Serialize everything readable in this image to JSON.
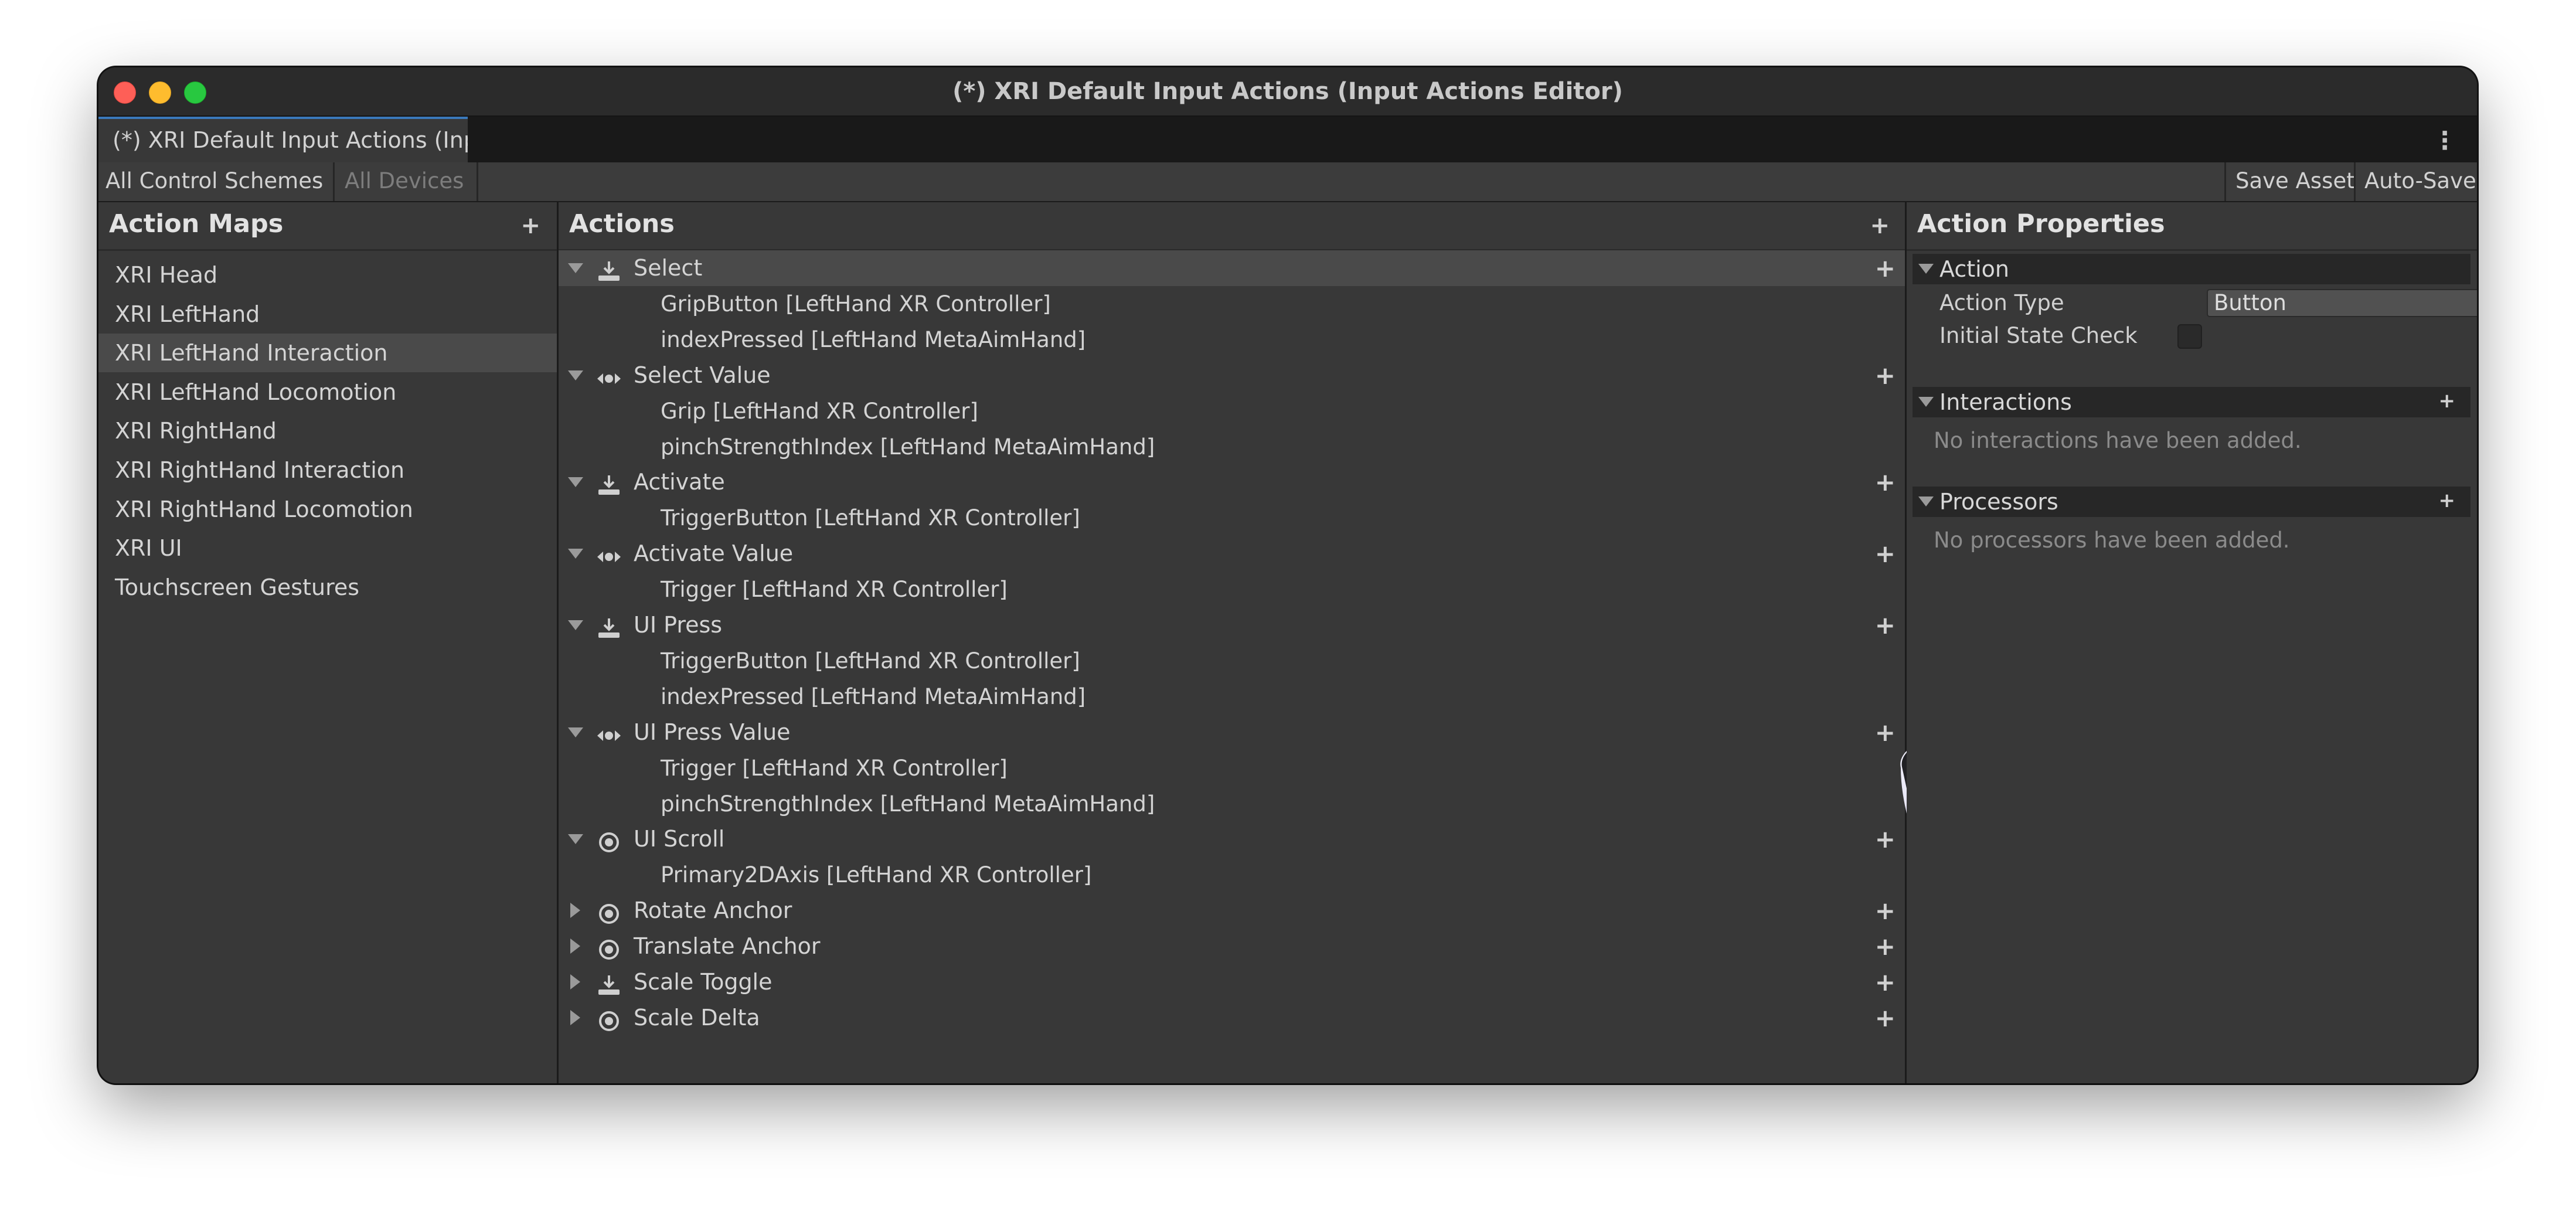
{
  "window": {
    "title": "(*) XRI Default Input Actions (Input Actions Editor)",
    "tab_label": "(*) XRI Default Input Actions (Inpu"
  },
  "toolbar": {
    "control_scheme": "All Control Schemes",
    "devices": "All Devices",
    "save_asset": "Save Asset",
    "auto_save": "Auto-Save"
  },
  "action_maps": {
    "title": "Action Maps",
    "items": [
      "XRI Head",
      "XRI LeftHand",
      "XRI LeftHand Interaction",
      "XRI LeftHand Locomotion",
      "XRI RightHand",
      "XRI RightHand Interaction",
      "XRI RightHand Locomotion",
      "XRI UI",
      "Touchscreen Gestures"
    ],
    "selected": "XRI LeftHand Interaction"
  },
  "actions": {
    "title": "Actions",
    "selected": "Select",
    "rows": [
      {
        "kind": "action",
        "label": "Select",
        "icon": "button-action-icon",
        "expanded": true
      },
      {
        "kind": "binding",
        "label": "GripButton [LeftHand XR Controller]"
      },
      {
        "kind": "binding",
        "label": "indexPressed [LeftHand MetaAimHand]"
      },
      {
        "kind": "action",
        "label": "Select Value",
        "icon": "value-action-icon",
        "expanded": true
      },
      {
        "kind": "binding",
        "label": "Grip [LeftHand XR Controller]"
      },
      {
        "kind": "binding",
        "label": "pinchStrengthIndex [LeftHand MetaAimHand]"
      },
      {
        "kind": "action",
        "label": "Activate",
        "icon": "button-action-icon",
        "expanded": true
      },
      {
        "kind": "binding",
        "label": "TriggerButton [LeftHand XR Controller]"
      },
      {
        "kind": "action",
        "label": "Activate Value",
        "icon": "value-action-icon",
        "expanded": true
      },
      {
        "kind": "binding",
        "label": "Trigger [LeftHand XR Controller]"
      },
      {
        "kind": "action",
        "label": "UI Press",
        "icon": "button-action-icon",
        "expanded": true
      },
      {
        "kind": "binding",
        "label": "TriggerButton [LeftHand XR Controller]"
      },
      {
        "kind": "binding",
        "label": "indexPressed [LeftHand MetaAimHand]"
      },
      {
        "kind": "action",
        "label": "UI Press Value",
        "icon": "value-action-icon",
        "expanded": true
      },
      {
        "kind": "binding",
        "label": "Trigger [LeftHand XR Controller]"
      },
      {
        "kind": "binding",
        "label": "pinchStrengthIndex [LeftHand MetaAimHand]"
      },
      {
        "kind": "action",
        "label": "UI Scroll",
        "icon": "passthrough-action-icon",
        "expanded": true
      },
      {
        "kind": "binding",
        "label": "Primary2DAxis [LeftHand XR Controller]"
      },
      {
        "kind": "action",
        "label": "Rotate Anchor",
        "icon": "passthrough-action-icon",
        "expanded": false
      },
      {
        "kind": "action",
        "label": "Translate Anchor",
        "icon": "passthrough-action-icon",
        "expanded": false
      },
      {
        "kind": "action",
        "label": "Scale Toggle",
        "icon": "button-action-icon",
        "expanded": false
      },
      {
        "kind": "action",
        "label": "Scale Delta",
        "icon": "passthrough-action-icon",
        "expanded": false
      }
    ]
  },
  "properties": {
    "title": "Action Properties",
    "action_section": "Action",
    "action_type_label": "Action Type",
    "action_type_value": "Button",
    "initial_state_label": "Initial State Check",
    "initial_state_checked": false,
    "interactions_section": "Interactions",
    "interactions_empty": "No interactions have been added.",
    "processors_section": "Processors",
    "processors_empty": "No processors have been added."
  },
  "colors": {
    "window_bg": "#383838",
    "selected_row": "#4a4a4a",
    "tab_accent": "#3a79bb",
    "text": "#d4d4d4"
  }
}
